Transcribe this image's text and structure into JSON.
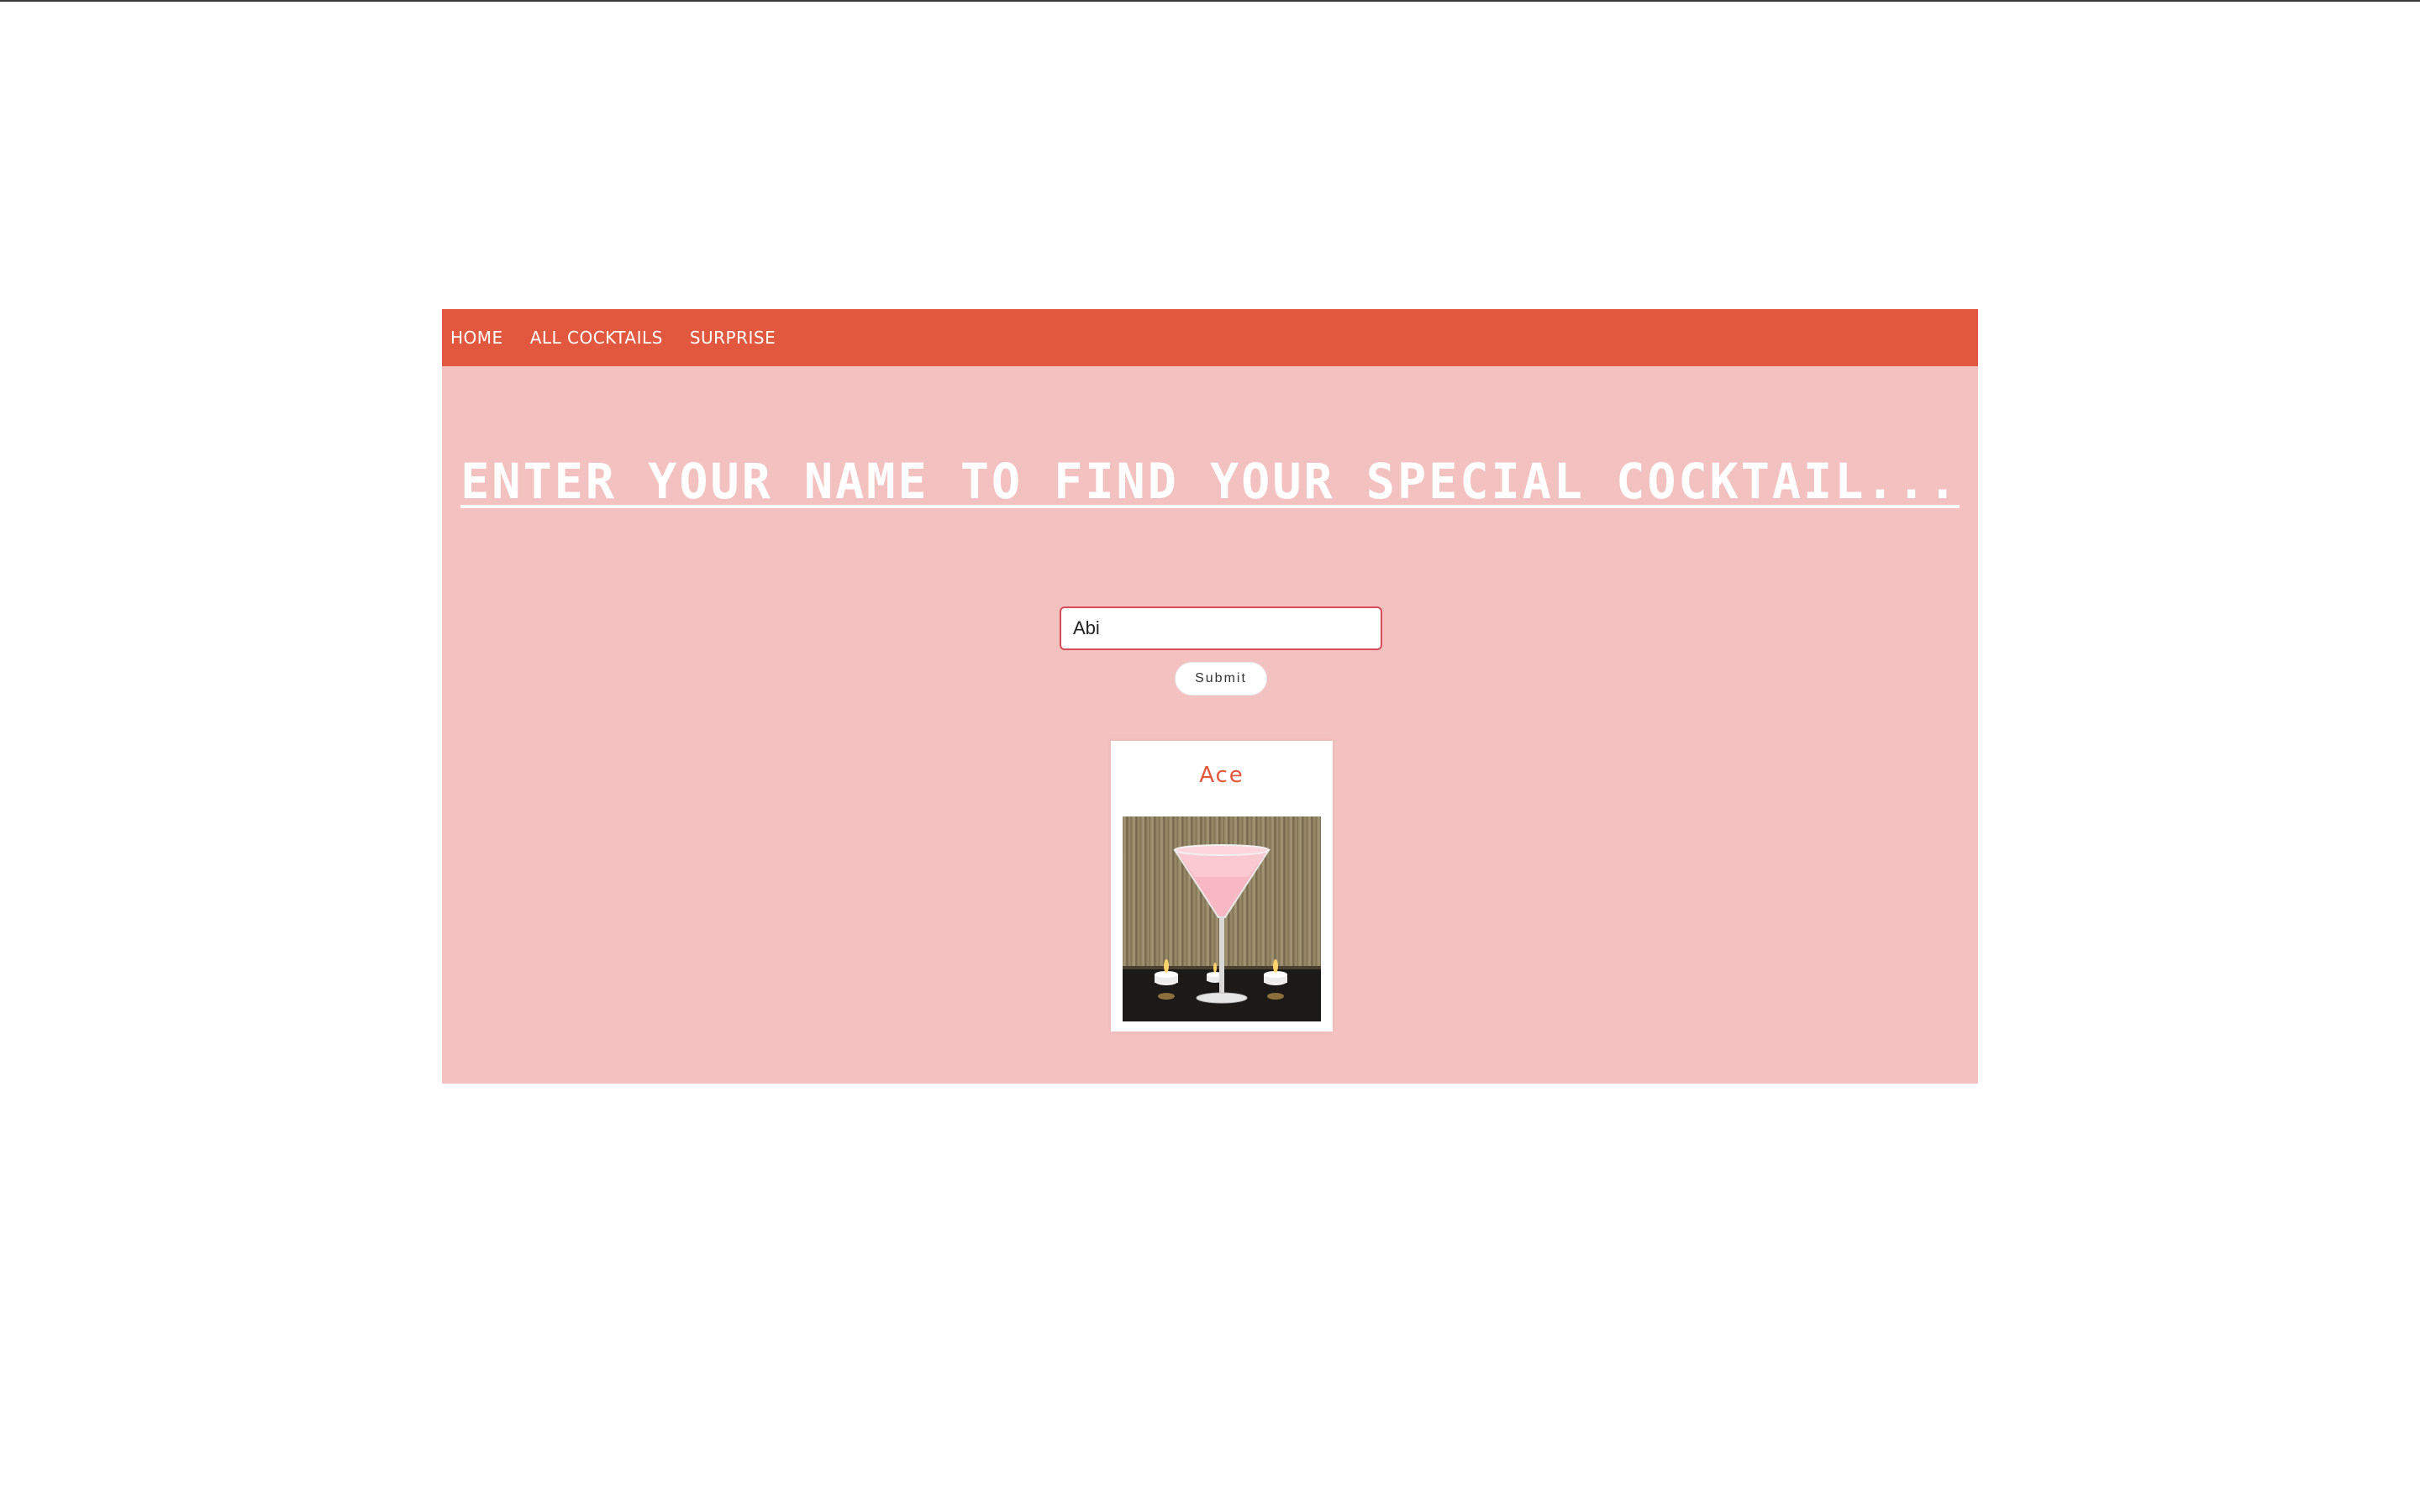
{
  "nav": {
    "items": [
      {
        "label": "HOME"
      },
      {
        "label": "ALL COCKTAILS"
      },
      {
        "label": "SURPRISE"
      }
    ]
  },
  "headline": "ENTER YOUR NAME TO FIND YOUR SPECIAL COCKTAIL...",
  "form": {
    "name_value": "Abi",
    "submit_label": "Submit"
  },
  "result": {
    "cocktail_name": "Ace",
    "image_icon": "pink-martini-photo"
  },
  "colors": {
    "navbar": "#e1583e",
    "panel": "#f4c1c1",
    "accent": "#e1583e",
    "input_border": "#d94a5c"
  }
}
